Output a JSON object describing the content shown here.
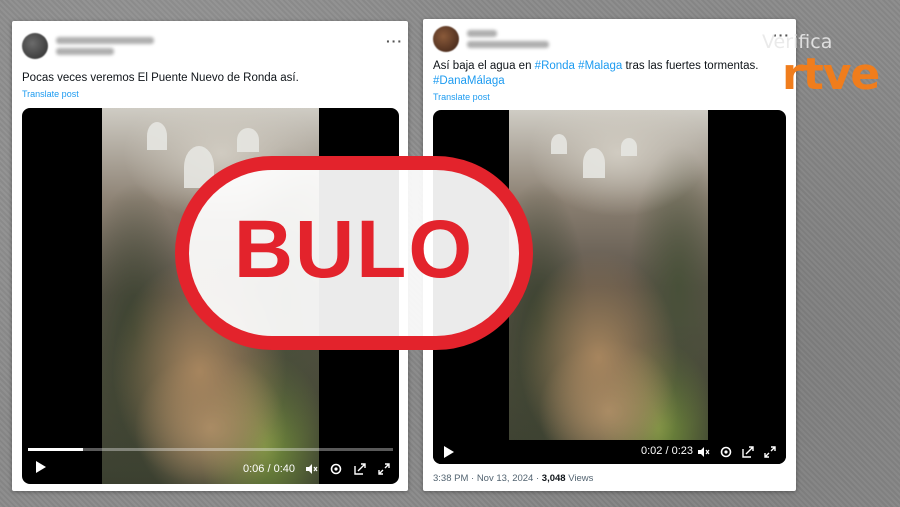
{
  "colors": {
    "background": "#8a8a8a",
    "card": "#ffffff",
    "link": "#1d9bf0",
    "stamp": "#e3232c",
    "rtve_orange": "#f07d1c"
  },
  "post1": {
    "text": "Pocas veces veremos El Puente Nuevo de Ronda así.",
    "translate": "Translate post",
    "video": {
      "time": "0:06 / 0:40",
      "progress": 0.15,
      "icons": [
        "play-icon",
        "volume-icon",
        "settings-icon",
        "share-icon",
        "fullscreen-icon"
      ]
    }
  },
  "post2": {
    "text_before": "Así baja el agua en ",
    "hashtag1": "#Ronda",
    "hashtag2": "#Malaga",
    "text_after": " tras las fuertes tormentas.",
    "hashtag3": "#DanaMálaga",
    "translate": "Translate post",
    "video": {
      "time": "0:02 / 0:23",
      "progress": 0.09,
      "icons": [
        "play-icon",
        "volume-icon",
        "settings-icon",
        "share-icon",
        "fullscreen-icon"
      ]
    },
    "footer": {
      "datetime": "3:38 PM · Nov 13, 2024 · ",
      "views_count": "3,048",
      "views_label": " Views"
    }
  },
  "stamp": {
    "word": "BULO"
  },
  "logo": {
    "top": "Verifica",
    "bottom": "rtve"
  }
}
